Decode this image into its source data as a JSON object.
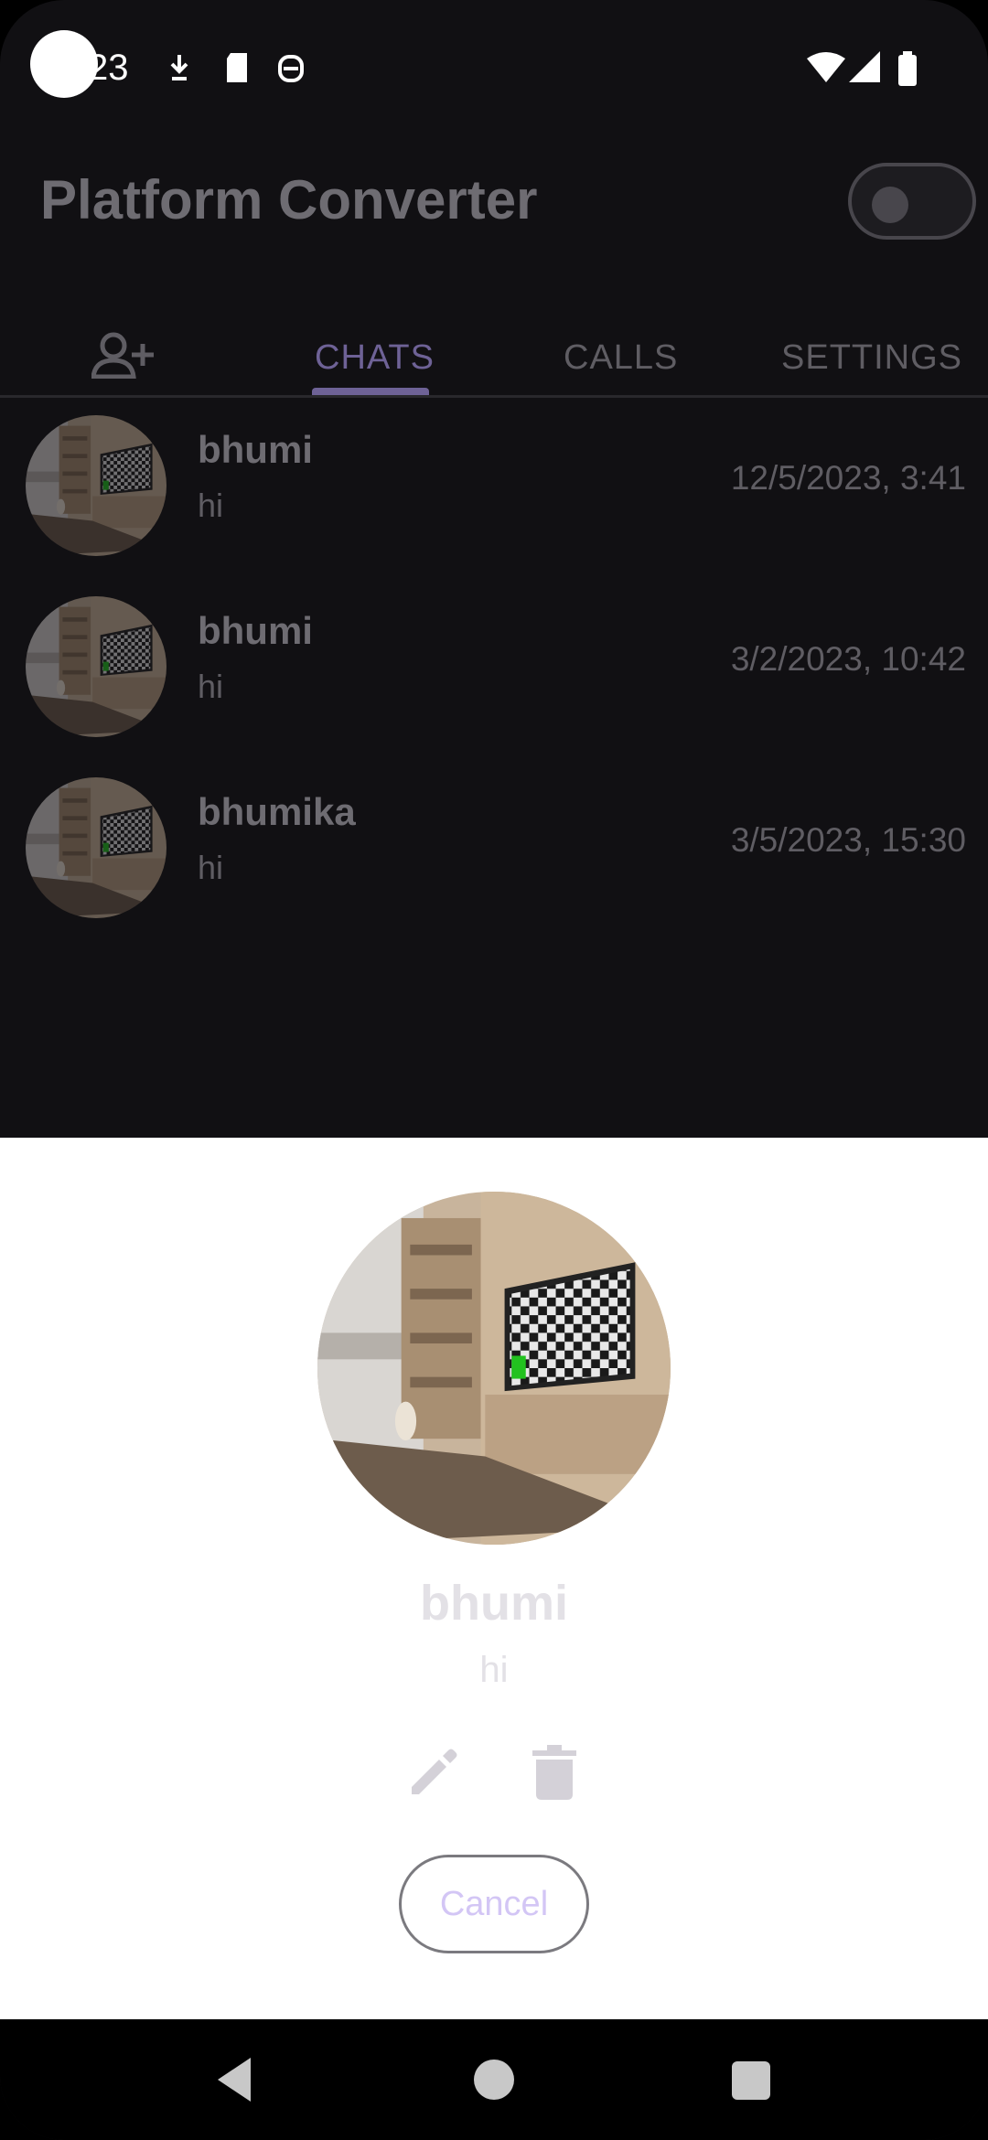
{
  "status": {
    "time": "23",
    "icons": [
      "download-icon",
      "sd-card-icon",
      "debug-icon",
      "wifi-icon",
      "signal-icon",
      "battery-icon"
    ]
  },
  "app": {
    "title": "Platform Converter",
    "toggle_state": "off"
  },
  "tabs": [
    {
      "label": "",
      "icon": "add-contact-icon"
    },
    {
      "label": "CHATS",
      "active": true
    },
    {
      "label": "CALLS"
    },
    {
      "label": "SETTINGS"
    }
  ],
  "chats": [
    {
      "name": "bhumi",
      "message": "hi",
      "time": "12/5/2023, 3:41"
    },
    {
      "name": "bhumi",
      "message": "hi",
      "time": "3/2/2023, 10:42"
    },
    {
      "name": "bhumika",
      "message": "hi",
      "time": "3/5/2023, 15:30"
    }
  ],
  "sheet": {
    "name": "bhumi",
    "message": "hi",
    "cancel_label": "Cancel"
  },
  "colors": {
    "background": "#111013",
    "accent": "#6e6296",
    "sheet": "#ffffff"
  }
}
